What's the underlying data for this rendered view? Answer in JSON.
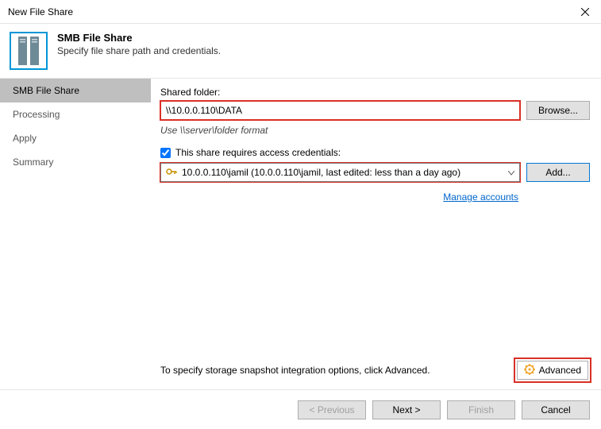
{
  "titlebar": {
    "title": "New File Share"
  },
  "header": {
    "title": "SMB File Share",
    "subtitle": "Specify file share path and credentials."
  },
  "sidebar": {
    "items": [
      {
        "label": "SMB File Share",
        "active": true
      },
      {
        "label": "Processing",
        "active": false
      },
      {
        "label": "Apply",
        "active": false
      },
      {
        "label": "Summary",
        "active": false
      }
    ]
  },
  "content": {
    "shared_folder_label": "Shared folder:",
    "shared_folder_value": "\\\\10.0.0.110\\DATA",
    "browse_label": "Browse...",
    "path_hint": "Use \\\\server\\folder format",
    "creds_checkbox_label": "This share requires access credentials:",
    "creds_selected": "10.0.0.110\\jamil (10.0.0.110\\jamil, last edited: less than a day ago)",
    "add_label": "Add...",
    "manage_accounts": "Manage accounts",
    "advanced_hint": "To specify storage snapshot integration options, click Advanced.",
    "advanced_label": "Advanced"
  },
  "footer": {
    "previous": "< Previous",
    "next": "Next >",
    "finish": "Finish",
    "cancel": "Cancel"
  }
}
